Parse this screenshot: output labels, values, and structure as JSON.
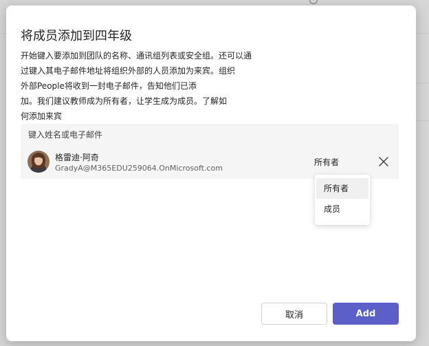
{
  "dialog": {
    "title": "将成员添加到四年级",
    "description_lines": [
      "开始键入要添加到团队的名称、通讯组列表或安全组。还可以通",
      "过键入其电子邮件地址将组织外部的人员添加为来宾。组织",
      "外部People将收到一封电子邮件，告知他们已添",
      "加。我们建议教师成为所有者，让学生成为成员。了解如",
      "何添加来宾"
    ]
  },
  "people_picker": {
    "placeholder": "键入姓名或电子邮件"
  },
  "person": {
    "name": "格雷迪·阿奇",
    "email": "GradyA@M365EDU259064.OnMicrosoft.com",
    "role": "所有者"
  },
  "role_menu": {
    "options": [
      "所有者",
      "成员"
    ]
  },
  "buttons": {
    "cancel": "取消",
    "add": "Add"
  },
  "colors": {
    "primary": "#5b5fc7",
    "surface": "#ffffff",
    "field_bg": "#f5f5f5"
  }
}
